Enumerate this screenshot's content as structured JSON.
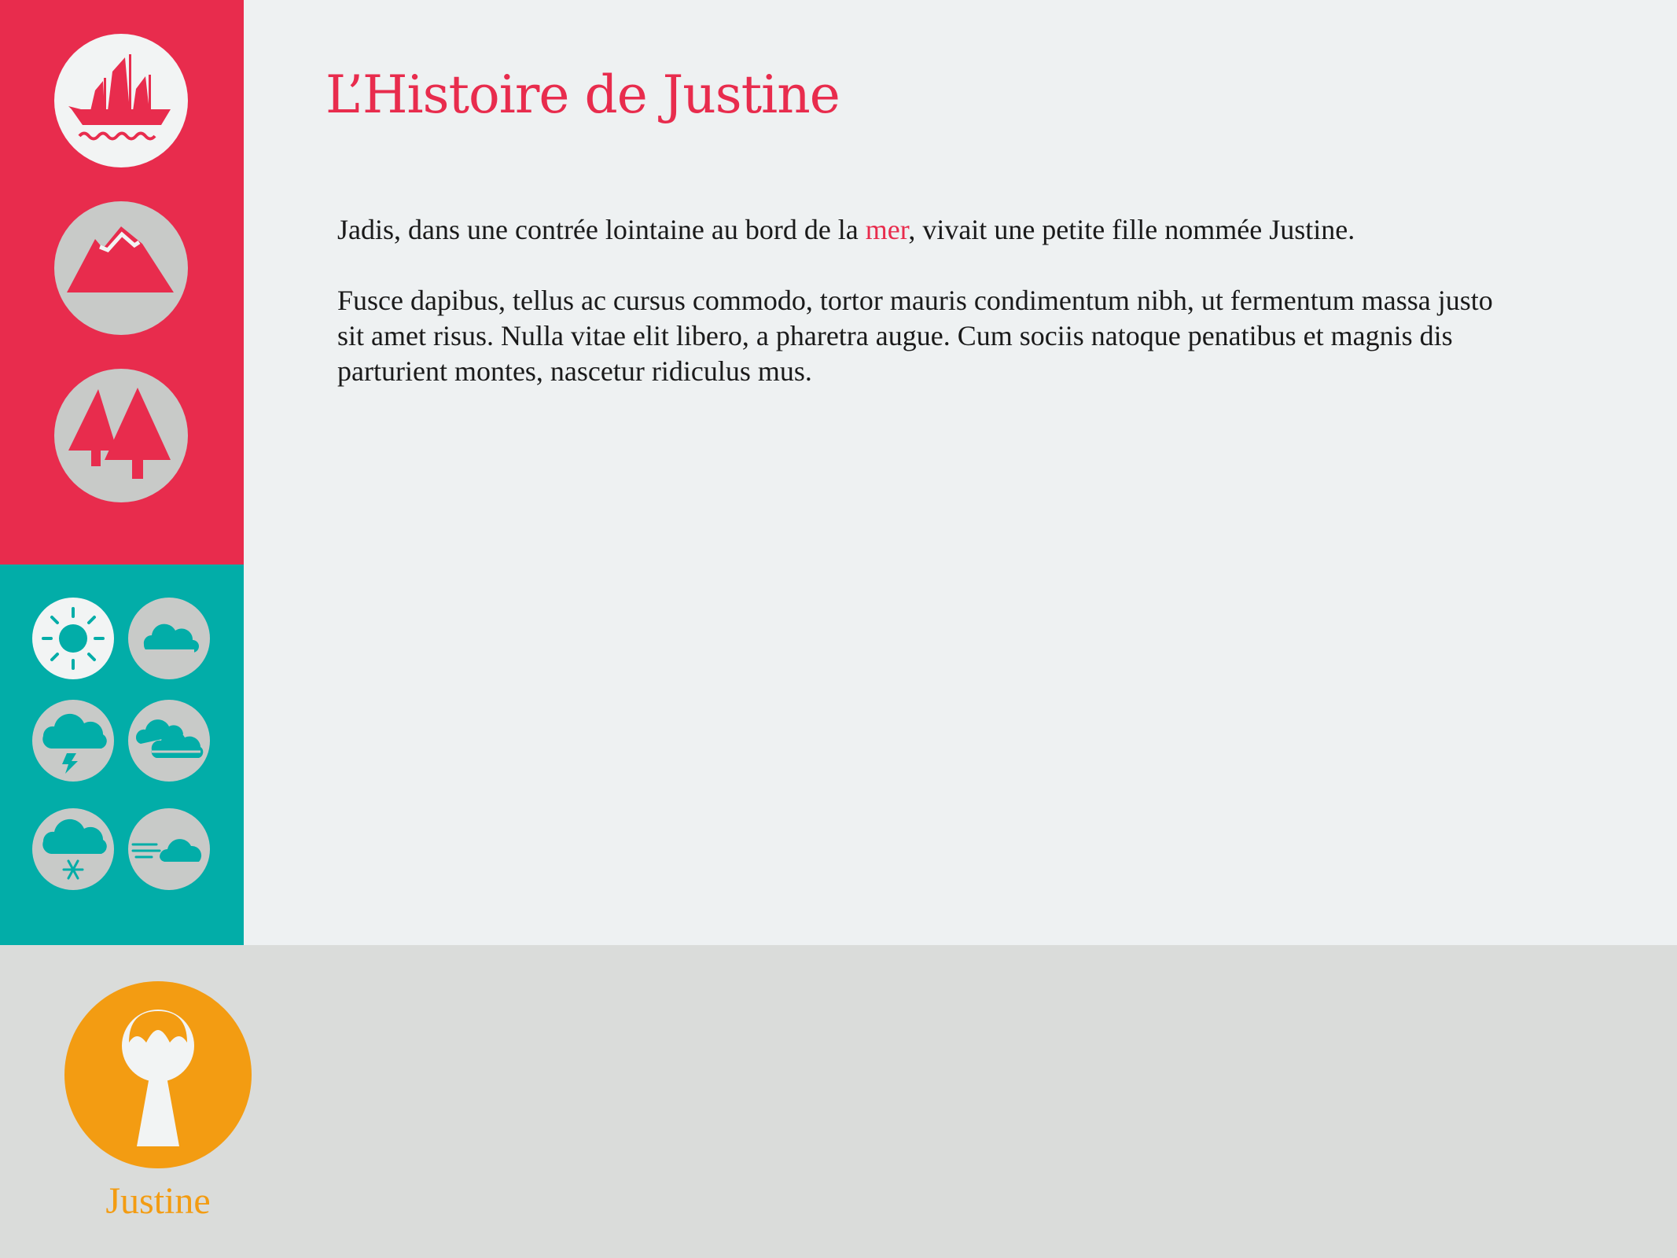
{
  "title": "L’Histoire de Justine",
  "story": {
    "para1_before": "Jadis, dans une contrée lointaine au bord de la ",
    "para1_highlight": "mer",
    "para1_after": ", vivait une petite fille nommée Justine.",
    "para2": "Fusce dapibus, tellus ac cursus commodo, tortor mauris condimentum nibh, ut fermentum massa justo sit amet risus. Nulla vitae elit libero, a pharetra augue. Cum sociis natoque penatibus et magnis dis parturient montes, nascetur ridiculus mus."
  },
  "scenes": [
    {
      "icon": "ship-icon",
      "selected": true
    },
    {
      "icon": "mountain-icon",
      "selected": false
    },
    {
      "icon": "forest-icon",
      "selected": false
    }
  ],
  "weather": [
    {
      "icon": "sun-icon",
      "selected": true
    },
    {
      "icon": "cloud-icon",
      "selected": false
    },
    {
      "icon": "storm-icon",
      "selected": false
    },
    {
      "icon": "clouds-icon",
      "selected": false
    },
    {
      "icon": "snow-icon",
      "selected": false
    },
    {
      "icon": "wind-icon",
      "selected": false
    }
  ],
  "character": {
    "name": "Justine",
    "icon": "girl-icon"
  },
  "colors": {
    "accent_red": "#e82c4d",
    "accent_teal": "#02ada8",
    "accent_orange": "#f39c12",
    "content_bg": "#eef1f2",
    "footer_bg": "#dadcda",
    "icon_grey": "#c8cac8",
    "icon_selected": "#f2f4f4"
  }
}
